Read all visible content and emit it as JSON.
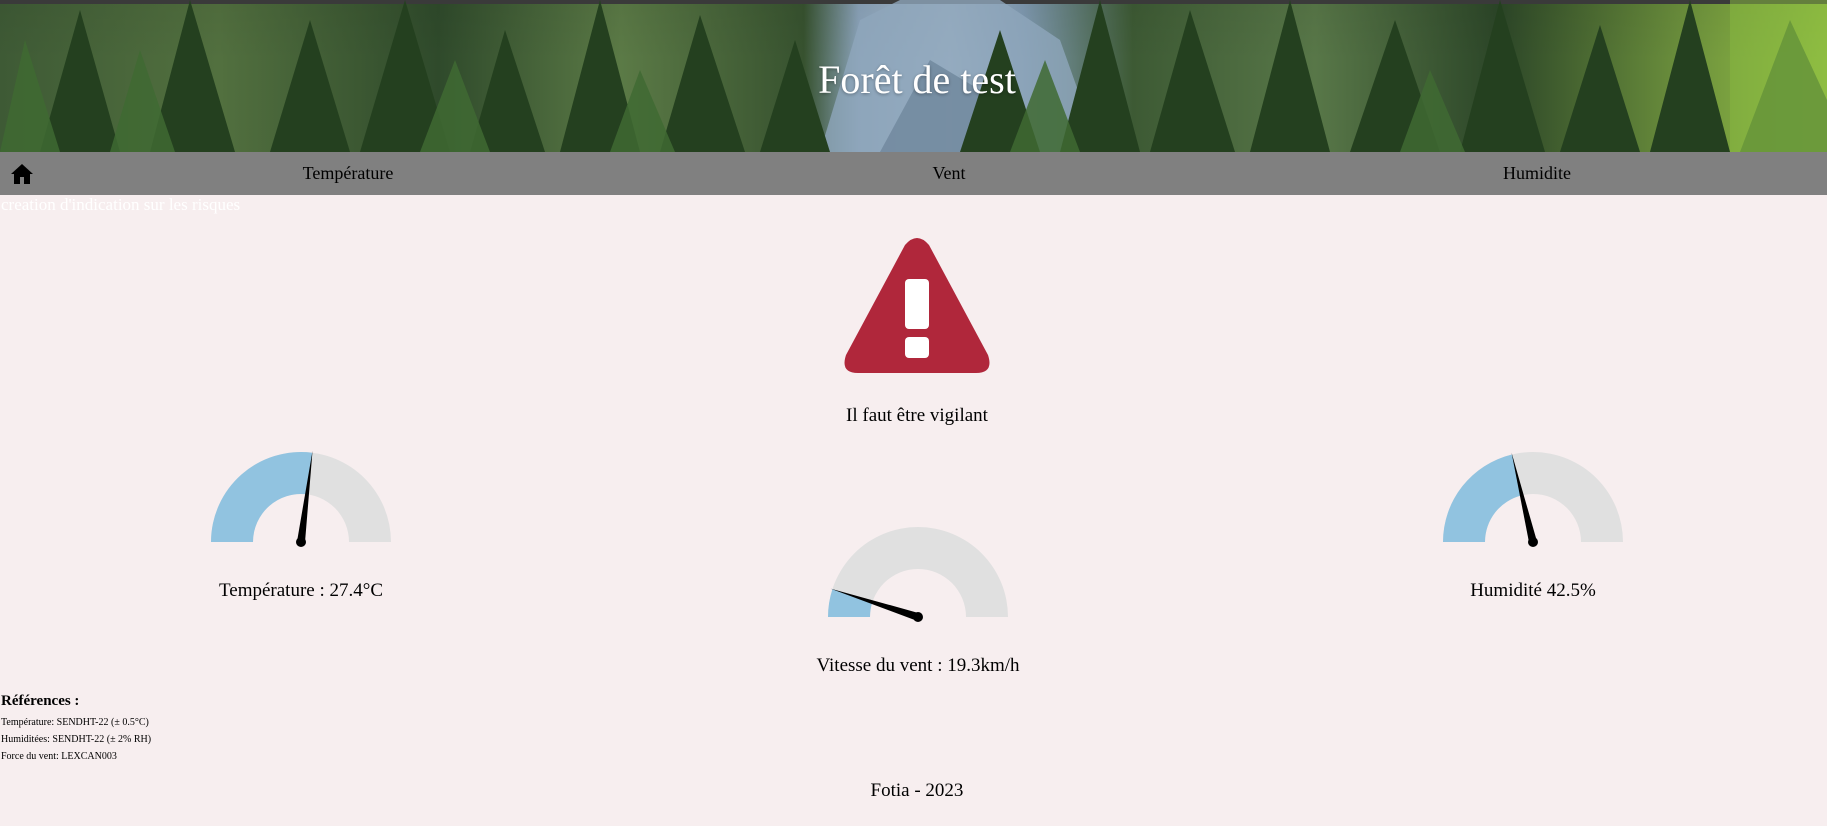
{
  "header": {
    "title": "Forêt de test"
  },
  "nav": {
    "home_icon": "home-icon",
    "items": [
      {
        "label": "Température"
      },
      {
        "label": "Vent"
      },
      {
        "label": "Humidite"
      }
    ]
  },
  "subline": "creation d'indication sur les risques",
  "alert": {
    "icon": "warning-triangle-icon",
    "color": "#b0273b",
    "message": "Il faut être vigilant"
  },
  "gauges": {
    "fill_color": "#91c3e0",
    "track_color": "#e0e0e0",
    "needle_color": "#000000",
    "temperature": {
      "label": "Température : 27.4°C",
      "level": 0.54
    },
    "wind": {
      "label": "Vitesse du vent : 19.3km/h",
      "level": 0.1
    },
    "humidity": {
      "label": "Humidité 42.5%",
      "level": 0.425
    }
  },
  "references": {
    "title": "Références :",
    "lines": [
      "Température: SENDHT-22 (± 0.5°C)",
      "Humiditées: SENDHT-22 (± 2% RH)",
      "Force du vent: LEXCAN003"
    ]
  },
  "footer": "Fotia - 2023"
}
